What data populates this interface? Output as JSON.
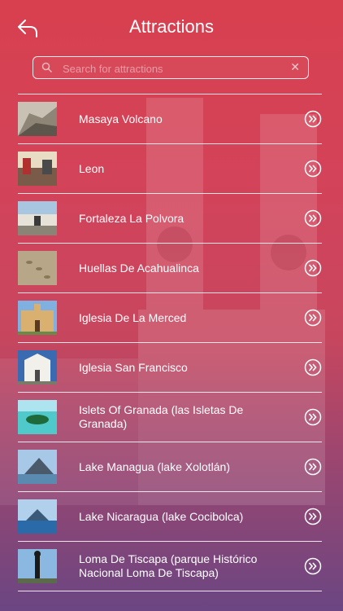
{
  "header": {
    "title": "Attractions"
  },
  "search": {
    "placeholder": "Search for attractions"
  },
  "items": [
    {
      "label": "Masaya Volcano"
    },
    {
      "label": "Leon"
    },
    {
      "label": "Fortaleza La Polvora"
    },
    {
      "label": "Huellas De Acahualinca"
    },
    {
      "label": "Iglesia De La Merced"
    },
    {
      "label": "Iglesia San Francisco"
    },
    {
      "label": "Islets Of Granada (las Isletas De Granada)"
    },
    {
      "label": "Lake Managua (lake Xolotlán)"
    },
    {
      "label": "Lake Nicaragua (lake Cocibolca)"
    },
    {
      "label": "Loma De Tiscapa (parque Histórico Nacional Loma De Tiscapa)"
    }
  ]
}
